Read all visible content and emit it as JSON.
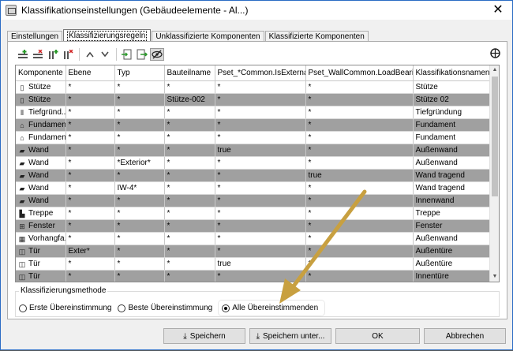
{
  "window": {
    "title": "Klassifikationseinstellungen (Gebäudeelemente - Al...)",
    "close": "✕"
  },
  "tabs": [
    {
      "label": "Einstellungen",
      "active": false
    },
    {
      "label": "Klassifizierungsregeln",
      "active": true
    },
    {
      "label": "Unklassifizierte Komponenten",
      "active": false
    },
    {
      "label": "Klassifizierte Komponenten",
      "active": false
    }
  ],
  "toolbar": {
    "icons": [
      "add-row-icon",
      "delete-row-icon",
      "insert-column-icon",
      "delete-column-icon",
      "move-up-icon",
      "move-down-icon",
      "import-icon",
      "export-icon",
      "hide-icon"
    ],
    "globe": "globe-icon"
  },
  "table": {
    "columns": [
      "Komponente",
      "Ebene",
      "Typ",
      "Bauteilname",
      "Pset_*Common.IsExternal",
      "Pset_WallCommon.LoadBearing",
      "Klassifikationsnamen"
    ],
    "rows": [
      {
        "icon": "column-icon",
        "cells": [
          "Stütze",
          "*",
          "*",
          "*",
          "*",
          "*",
          "Stütze"
        ],
        "shade": "white"
      },
      {
        "icon": "column-icon",
        "cells": [
          "Stütze",
          "*",
          "*",
          "Stütze-002",
          "*",
          "*",
          "Stütze 02"
        ],
        "shade": "gray"
      },
      {
        "icon": "pile-icon",
        "cells": [
          "Tiefgründ...",
          "*",
          "*",
          "*",
          "*",
          "*",
          "Tiefgründung"
        ],
        "shade": "white"
      },
      {
        "icon": "footing-icon",
        "cells": [
          "Fundament",
          "*",
          "*",
          "*",
          "*",
          "*",
          "Fundament"
        ],
        "shade": "gray"
      },
      {
        "icon": "footing-icon",
        "cells": [
          "Fundament",
          "*",
          "*",
          "*",
          "*",
          "*",
          "Fundament"
        ],
        "shade": "white"
      },
      {
        "icon": "wall-icon",
        "cells": [
          "Wand",
          "*",
          "*",
          "*",
          "true",
          "*",
          "Außenwand"
        ],
        "shade": "gray"
      },
      {
        "icon": "wall-icon",
        "cells": [
          "Wand",
          "*",
          "*Exterior*",
          "*",
          "*",
          "*",
          "Außenwand"
        ],
        "shade": "white"
      },
      {
        "icon": "wall-icon",
        "cells": [
          "Wand",
          "*",
          "*",
          "*",
          "*",
          "true",
          "Wand tragend"
        ],
        "shade": "gray"
      },
      {
        "icon": "wall-icon",
        "cells": [
          "Wand",
          "*",
          "IW-4*",
          "*",
          "*",
          "*",
          "Wand tragend"
        ],
        "shade": "white"
      },
      {
        "icon": "wall-icon",
        "cells": [
          "Wand",
          "*",
          "*",
          "*",
          "*",
          "*",
          "Innenwand"
        ],
        "shade": "gray"
      },
      {
        "icon": "stair-icon",
        "cells": [
          "Treppe",
          "*",
          "*",
          "*",
          "*",
          "*",
          "Treppe"
        ],
        "shade": "white"
      },
      {
        "icon": "window-icon",
        "cells": [
          "Fenster",
          "*",
          "*",
          "*",
          "*",
          "*",
          "Fenster"
        ],
        "shade": "gray"
      },
      {
        "icon": "curtainwall-icon",
        "cells": [
          "Vorhangfa...",
          "*",
          "*",
          "*",
          "*",
          "*",
          "Außenwand"
        ],
        "shade": "white"
      },
      {
        "icon": "door-icon",
        "cells": [
          "Tür",
          "Exter*",
          "*",
          "*",
          "*",
          "*",
          "Außentüre"
        ],
        "shade": "gray"
      },
      {
        "icon": "door-icon",
        "cells": [
          "Tür",
          "*",
          "*",
          "*",
          "true",
          "*",
          "Außentüre"
        ],
        "shade": "white"
      },
      {
        "icon": "door-icon",
        "cells": [
          "Tür",
          "*",
          "*",
          "*",
          "*",
          "*",
          "Innentüre"
        ],
        "shade": "gray"
      }
    ]
  },
  "method": {
    "legend": "Klassifizierungsmethode",
    "options": [
      {
        "label": "Erste Übereinstimmung",
        "selected": false
      },
      {
        "label": "Beste Übereinstimmung",
        "selected": false
      },
      {
        "label": "Alle Übereinstimmenden",
        "selected": true
      }
    ]
  },
  "buttons": {
    "save": "Speichern",
    "save_as": "Speichern unter...",
    "ok": "OK",
    "cancel": "Abbrechen"
  },
  "colors": {
    "accent": "#2b6cc4",
    "annotation_arrow": "#c8a040",
    "gray_row": "#a0a0a0"
  }
}
